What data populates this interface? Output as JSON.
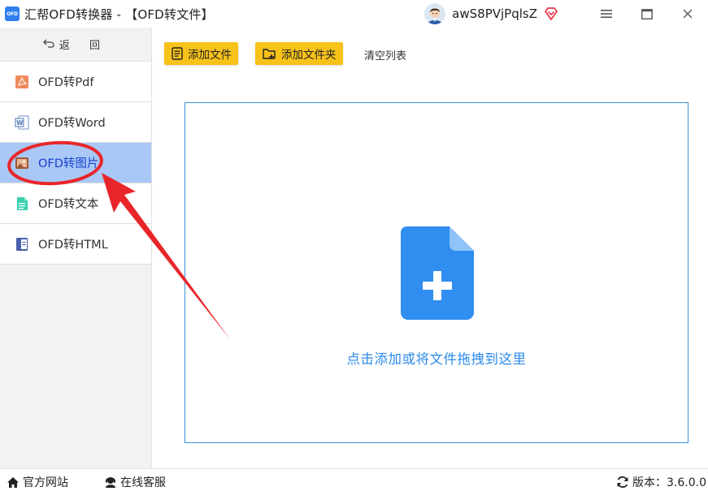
{
  "window": {
    "logo_text": "OFD",
    "title": "汇帮OFD转换器 - 【OFD转文件】",
    "username": "awS8PVjPqlsZ"
  },
  "sidebar": {
    "back_label": "返 回",
    "items": [
      {
        "label": "OFD转Pdf",
        "icon": "pdf-icon",
        "active": false
      },
      {
        "label": "OFD转Word",
        "icon": "word-icon",
        "active": false
      },
      {
        "label": "OFD转图片",
        "icon": "image-icon",
        "active": true
      },
      {
        "label": "OFD转文本",
        "icon": "text-file-icon",
        "active": false
      },
      {
        "label": "OFD转HTML",
        "icon": "html-icon",
        "active": false
      }
    ]
  },
  "toolbar": {
    "add_file_label": "添加文件",
    "add_folder_label": "添加文件夹",
    "clear_label": "清空列表"
  },
  "dropzone": {
    "hint": "点击添加或将文件拖拽到这里"
  },
  "statusbar": {
    "website_label": "官方网站",
    "support_label": "在线客服",
    "version_label": "版本：3.6.0.0"
  },
  "colors": {
    "accent_yellow": "#f7c21a",
    "active_item_bg": "#a9c8f6",
    "link_blue": "#2b8ae8",
    "annotation_red": "#e8262a"
  }
}
